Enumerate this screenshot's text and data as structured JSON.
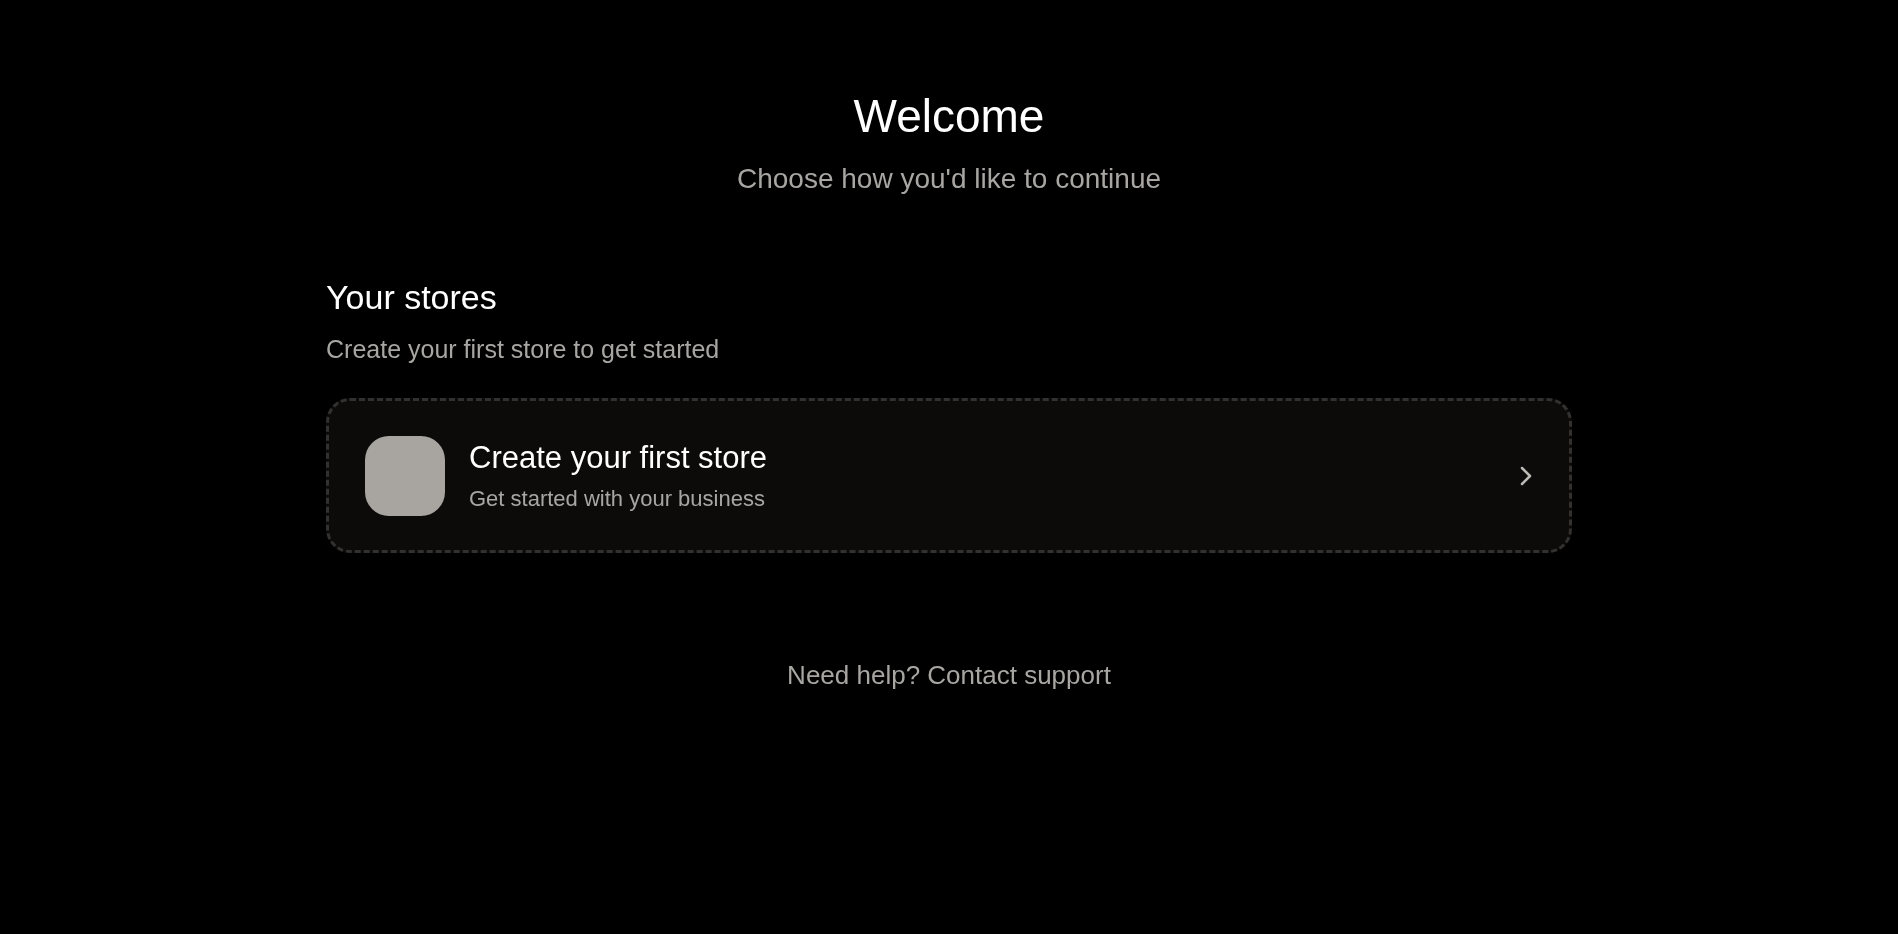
{
  "header": {
    "title": "Welcome",
    "subtitle": "Choose how you'd like to continue"
  },
  "stores": {
    "title": "Your stores",
    "subtitle": "Create your first store to get started",
    "cards": [
      {
        "kind": "create",
        "title": "Create your first store",
        "subtitle": "Get started with your business"
      }
    ]
  },
  "footer": {
    "help": "Need help? Contact support"
  }
}
